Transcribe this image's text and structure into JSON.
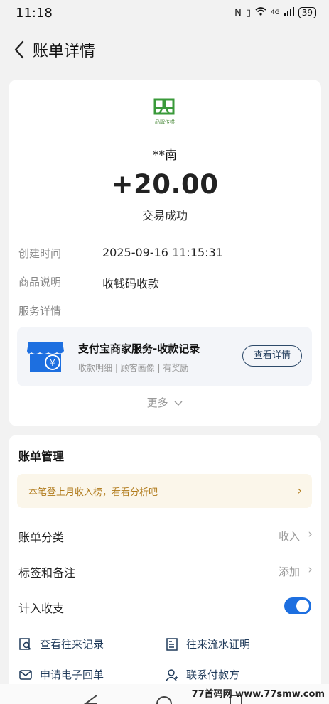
{
  "status_bar": {
    "time": "11:18",
    "network": "4G",
    "battery": "39"
  },
  "nav": {
    "title": "账单详情"
  },
  "transaction": {
    "merchant_logo_text": "品牌传媒",
    "merchant_name": "**南",
    "amount": "+20.00",
    "status": "交易成功"
  },
  "info_rows": [
    {
      "label": "创建时间",
      "value": "2025-09-16 11:15:31"
    },
    {
      "label": "商品说明",
      "value": "收钱码收款"
    },
    {
      "label": "服务详情",
      "value": ""
    }
  ],
  "service": {
    "title": "支付宝商家服务-收款记录",
    "subtitle": "收款明细 | 顾客画像 | 有奖励",
    "button": "查看详情"
  },
  "more": "更多",
  "management": {
    "title": "账单管理",
    "promo": "本笔登上月收入榜，看看分析吧",
    "rows": [
      {
        "label": "账单分类",
        "value": "收入"
      },
      {
        "label": "标签和备注",
        "value": "添加"
      },
      {
        "label": "计入收支",
        "value": ""
      }
    ],
    "include_in_stats": true,
    "links": [
      {
        "label": "查看往来记录",
        "icon": "search-doc-icon"
      },
      {
        "label": "往来流水证明",
        "icon": "certificate-icon"
      },
      {
        "label": "申请电子回单",
        "icon": "mail-icon"
      },
      {
        "label": "联系付款方",
        "icon": "contact-icon"
      }
    ]
  },
  "watermark": "77首码网 www.77smw.com",
  "colors": {
    "accent": "#1d6fe0",
    "promo_text": "#b07a1a",
    "logo_green": "#3a9a3a"
  }
}
